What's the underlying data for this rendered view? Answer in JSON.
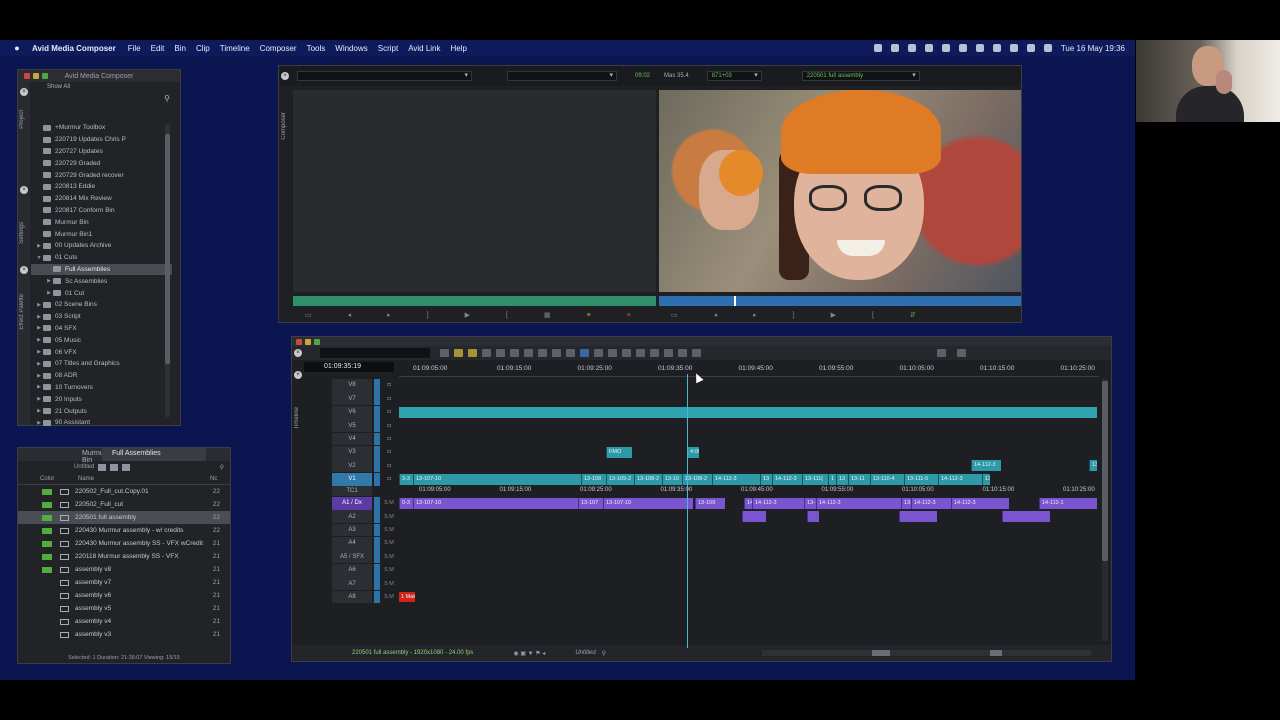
{
  "menubar": {
    "app_name": "Avid Media Composer",
    "menus": [
      "File",
      "Edit",
      "Bin",
      "Clip",
      "Timeline",
      "Composer",
      "Tools",
      "Windows",
      "Script",
      "Avid Link",
      "Help"
    ],
    "datetime": "Tue 16 May  19:36"
  },
  "project": {
    "title": "Avid Media Composer",
    "show_all": "Show All",
    "tabs": [
      "Project",
      "Settings",
      "Effect Palette"
    ],
    "items": [
      {
        "label": "+Murmur Toolbox",
        "indent": 0,
        "arrow": ""
      },
      {
        "label": "220719 Updates Chris P",
        "indent": 0,
        "arrow": ""
      },
      {
        "label": "220727 Updates",
        "indent": 0,
        "arrow": ""
      },
      {
        "label": "220729 Graded",
        "indent": 0,
        "arrow": ""
      },
      {
        "label": "220729 Graded recover",
        "indent": 0,
        "arrow": ""
      },
      {
        "label": "220813 Eddie",
        "indent": 0,
        "arrow": ""
      },
      {
        "label": "220814 Mix Review",
        "indent": 0,
        "arrow": ""
      },
      {
        "label": "220817 Conform Bin",
        "indent": 0,
        "arrow": ""
      },
      {
        "label": "Murmur Bin",
        "indent": 0,
        "arrow": ""
      },
      {
        "label": "Murmur Bin1",
        "indent": 0,
        "arrow": ""
      },
      {
        "label": "00 Updates Archive",
        "indent": 0,
        "arrow": "▶"
      },
      {
        "label": "01 Cuts",
        "indent": 0,
        "arrow": "▼"
      },
      {
        "label": "Full Assemblies",
        "indent": 1,
        "arrow": "",
        "selected": true
      },
      {
        "label": "Sc Assemblies",
        "indent": 1,
        "arrow": "▶"
      },
      {
        "label": "01 Cut",
        "indent": 1,
        "arrow": "▶"
      },
      {
        "label": "02 Scene Bins",
        "indent": 0,
        "arrow": "▶"
      },
      {
        "label": "03 Script",
        "indent": 0,
        "arrow": "▶"
      },
      {
        "label": "04 SFX",
        "indent": 0,
        "arrow": "▶"
      },
      {
        "label": "05 Music",
        "indent": 0,
        "arrow": "▶"
      },
      {
        "label": "06 VFX",
        "indent": 0,
        "arrow": "▶"
      },
      {
        "label": "07 Titles and Graphics",
        "indent": 0,
        "arrow": "▶"
      },
      {
        "label": "08 ADR",
        "indent": 0,
        "arrow": "▶"
      },
      {
        "label": "10 Turnovers",
        "indent": 0,
        "arrow": "▶"
      },
      {
        "label": "20 Inputs",
        "indent": 0,
        "arrow": "▶"
      },
      {
        "label": "21 Outputs",
        "indent": 0,
        "arrow": "▶"
      },
      {
        "label": "90 Assistant",
        "indent": 0,
        "arrow": "▶"
      }
    ]
  },
  "bin": {
    "tabs": [
      "Murmur Bin",
      "Full Assemblies"
    ],
    "view_name": "Untitled",
    "side_tab": "Bins 1",
    "columns": [
      "Color",
      "Name",
      "Nc"
    ],
    "rows": [
      {
        "name": "220502_Full_cut.Copy.01",
        "nc": "22",
        "color": "#4fae3d"
      },
      {
        "name": "220502_Full_cut",
        "nc": "22",
        "color": "#4fae3d"
      },
      {
        "name": "220501 full assembly",
        "nc": "22",
        "color": "#4fae3d",
        "selected": true
      },
      {
        "name": "220430 Murmur assembly - w/ credits",
        "nc": "22",
        "color": "#4fae3d"
      },
      {
        "name": "220430 Murmur assembly SS - VFX wCredit",
        "nc": "21",
        "color": "#4fae3d"
      },
      {
        "name": "220118 Murmur assembly SS - VFX",
        "nc": "21",
        "color": "#4fae3d"
      },
      {
        "name": "assembly v8",
        "nc": "21",
        "color": "#4fae3d"
      },
      {
        "name": "assembly v7",
        "nc": "21",
        "color": ""
      },
      {
        "name": "assembly v6",
        "nc": "21",
        "color": ""
      },
      {
        "name": "assembly v5",
        "nc": "21",
        "color": ""
      },
      {
        "name": "assembly v4",
        "nc": "21",
        "color": ""
      },
      {
        "name": "assembly v3",
        "nc": "21",
        "color": ""
      }
    ],
    "status": "Selected: 1  Duration: 21:36:07  Viewing: 15/15"
  },
  "composer": {
    "side_tab": "Composer",
    "timecode_small": "09:02",
    "mas_label": "Mas  35.4",
    "record_value": "871+03",
    "sequence_name": "220501 full assembly"
  },
  "timeline": {
    "side_tab": "Timeline",
    "master_tc": "01:09:35:19",
    "ruler": [
      {
        "label": "01:09:05:00",
        "pos": 0.02
      },
      {
        "label": "01:09:15:00",
        "pos": 0.14
      },
      {
        "label": "01:09:25:00",
        "pos": 0.255
      },
      {
        "label": "01:09:35:00",
        "pos": 0.37
      },
      {
        "label": "01:09:45:00",
        "pos": 0.485
      },
      {
        "label": "01:09:55:00",
        "pos": 0.6
      },
      {
        "label": "01:10:05:00",
        "pos": 0.715
      },
      {
        "label": "01:10:15:00",
        "pos": 0.83
      },
      {
        "label": "01:10:25:00",
        "pos": 0.945
      }
    ],
    "tracks": {
      "video": [
        "V8",
        "V7",
        "V6",
        "V5",
        "V4",
        "V3",
        "V2",
        "V1"
      ],
      "tc": "TC1",
      "audio": [
        "A1 / Dx",
        "A2",
        "A3",
        "A4",
        "A5 / SFX",
        "A6",
        "A7",
        "A8"
      ]
    },
    "v1_clips": [
      "3-3",
      "13-107-10",
      "13-108",
      "13-109-2",
      "13-108-2",
      "13-10",
      "13-108-2",
      "14-112-3",
      "13",
      "14-112-3",
      "13-111(",
      "1",
      "13",
      "13-11",
      "13-110-4",
      "13-111-5",
      "14-112-3",
      "13"
    ],
    "a1_clips": [
      "0-3",
      "13-107-10",
      "13-107",
      "13-107-10",
      "13-109",
      "14-",
      "14-112-3",
      "13-",
      "14-112-3",
      "13-",
      "14-112-3",
      "14-112-3",
      "14-112-1"
    ],
    "tc_ruler": [
      "01:09:05:00",
      "01:09:15:00",
      "01:09:25:00",
      "01:09:35:00",
      "01:09:45:00",
      "01:09:55:00",
      "01:10:05:00",
      "01:10:15:00",
      "01:10:25:00"
    ],
    "v3_clips": [
      "FMO",
      "4:00"
    ],
    "v2_clips": [
      "14-112-3",
      "13"
    ],
    "a8_label": "1 Mak",
    "footer_sequence": "220501 full assembly - 1920x1080 - 24.00 fps",
    "footer_view": "Untitled"
  }
}
